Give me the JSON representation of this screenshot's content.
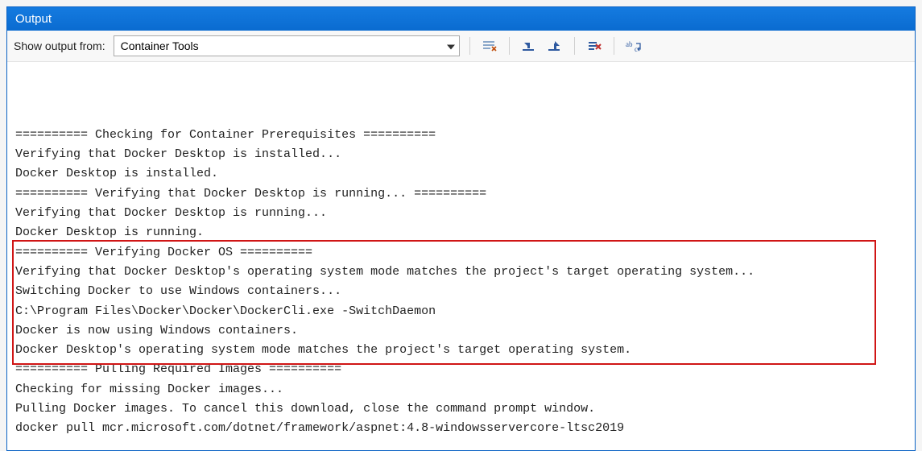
{
  "panel": {
    "title": "Output"
  },
  "toolbar": {
    "label": "Show output from:",
    "combo_value": "Container Tools"
  },
  "lines": [
    "========== Checking for Container Prerequisites ==========",
    "Verifying that Docker Desktop is installed...",
    "Docker Desktop is installed.",
    "========== Verifying that Docker Desktop is running... ==========",
    "Verifying that Docker Desktop is running...",
    "Docker Desktop is running.",
    "========== Verifying Docker OS ==========",
    "Verifying that Docker Desktop's operating system mode matches the project's target operating system...",
    "Switching Docker to use Windows containers...",
    "C:\\Program Files\\Docker\\Docker\\DockerCli.exe -SwitchDaemon",
    "Docker is now using Windows containers.",
    "Docker Desktop's operating system mode matches the project's target operating system.",
    "========== Pulling Required Images ==========",
    "Checking for missing Docker images...",
    "Pulling Docker images. To cancel this download, close the command prompt window.",
    "docker pull mcr.microsoft.com/dotnet/framework/aspnet:4.8-windowsservercore-ltsc2019"
  ],
  "highlight": {
    "first_line": 6,
    "last_line": 11
  }
}
